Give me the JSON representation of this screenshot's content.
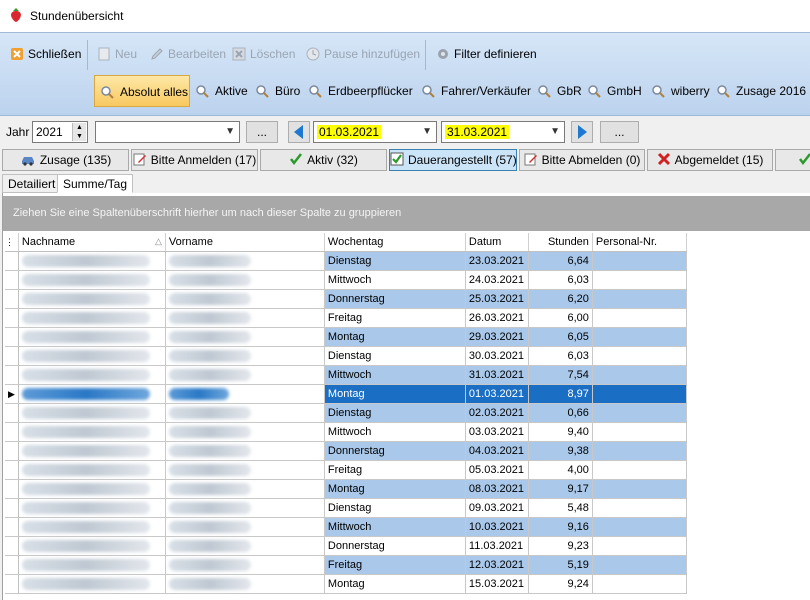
{
  "window": {
    "title": "Stundenübersicht"
  },
  "ribbon": {
    "close": "Schließen",
    "new": "Neu",
    "edit": "Bearbeiten",
    "delete": "Löschen",
    "pause": "Pause hinzufügen",
    "filter": "Filter definieren",
    "filters": [
      "Absolut alles",
      "Aktive",
      "Büro",
      "Erdbeerpflücker",
      "Fahrer/Verkäufer",
      "GbR",
      "GmbH",
      "wiberry",
      "Zusage 2016"
    ]
  },
  "toolbar": {
    "year_label": "Jahr",
    "year_value": "2021",
    "combo_value": "",
    "more_button_1": "...",
    "date_from": "01.03.2021",
    "date_to": "31.03.2021",
    "more_button_2": "..."
  },
  "status_buttons": [
    {
      "label": "Zusage (135)"
    },
    {
      "label": "Bitte Anmelden (17)"
    },
    {
      "label": "Aktiv (32)"
    },
    {
      "label": "Dauerangestellt (57)"
    },
    {
      "label": "Bitte Abmelden (0)"
    },
    {
      "label": "Abgemeldet (15)"
    }
  ],
  "tabs": [
    "Detailiert",
    "Summe/Tag"
  ],
  "grid": {
    "group_hint": "Ziehen Sie eine Spaltenüberschrift hierher um nach dieser Spalte zu gruppieren",
    "columns": [
      "Nachname",
      "Vorname",
      "Wochentag",
      "Datum",
      "Stunden",
      "Personal-Nr."
    ],
    "rows": [
      {
        "wochentag": "Dienstag",
        "datum": "23.03.2021",
        "stunden": "6,64"
      },
      {
        "wochentag": "Mittwoch",
        "datum": "24.03.2021",
        "stunden": "6,03"
      },
      {
        "wochentag": "Donnerstag",
        "datum": "25.03.2021",
        "stunden": "6,20"
      },
      {
        "wochentag": "Freitag",
        "datum": "26.03.2021",
        "stunden": "6,00"
      },
      {
        "wochentag": "Montag",
        "datum": "29.03.2021",
        "stunden": "6,05"
      },
      {
        "wochentag": "Dienstag",
        "datum": "30.03.2021",
        "stunden": "6,03"
      },
      {
        "wochentag": "Mittwoch",
        "datum": "31.03.2021",
        "stunden": "7,54"
      },
      {
        "wochentag": "Montag",
        "datum": "01.03.2021",
        "stunden": "8,97"
      },
      {
        "wochentag": "Dienstag",
        "datum": "02.03.2021",
        "stunden": "0,66"
      },
      {
        "wochentag": "Mittwoch",
        "datum": "03.03.2021",
        "stunden": "9,40"
      },
      {
        "wochentag": "Donnerstag",
        "datum": "04.03.2021",
        "stunden": "9,38"
      },
      {
        "wochentag": "Freitag",
        "datum": "05.03.2021",
        "stunden": "4,00"
      },
      {
        "wochentag": "Montag",
        "datum": "08.03.2021",
        "stunden": "9,17"
      },
      {
        "wochentag": "Dienstag",
        "datum": "09.03.2021",
        "stunden": "5,48"
      },
      {
        "wochentag": "Mittwoch",
        "datum": "10.03.2021",
        "stunden": "9,16"
      },
      {
        "wochentag": "Donnerstag",
        "datum": "11.03.2021",
        "stunden": "9,23"
      },
      {
        "wochentag": "Freitag",
        "datum": "12.03.2021",
        "stunden": "5,19"
      },
      {
        "wochentag": "Montag",
        "datum": "15.03.2021",
        "stunden": "9,24"
      }
    ]
  },
  "colors": {
    "row_alt": "#a9c8ea",
    "row_selected": "#1a6fc4",
    "highlight": "#ffff00",
    "ribbon": "#c9dcf2"
  }
}
